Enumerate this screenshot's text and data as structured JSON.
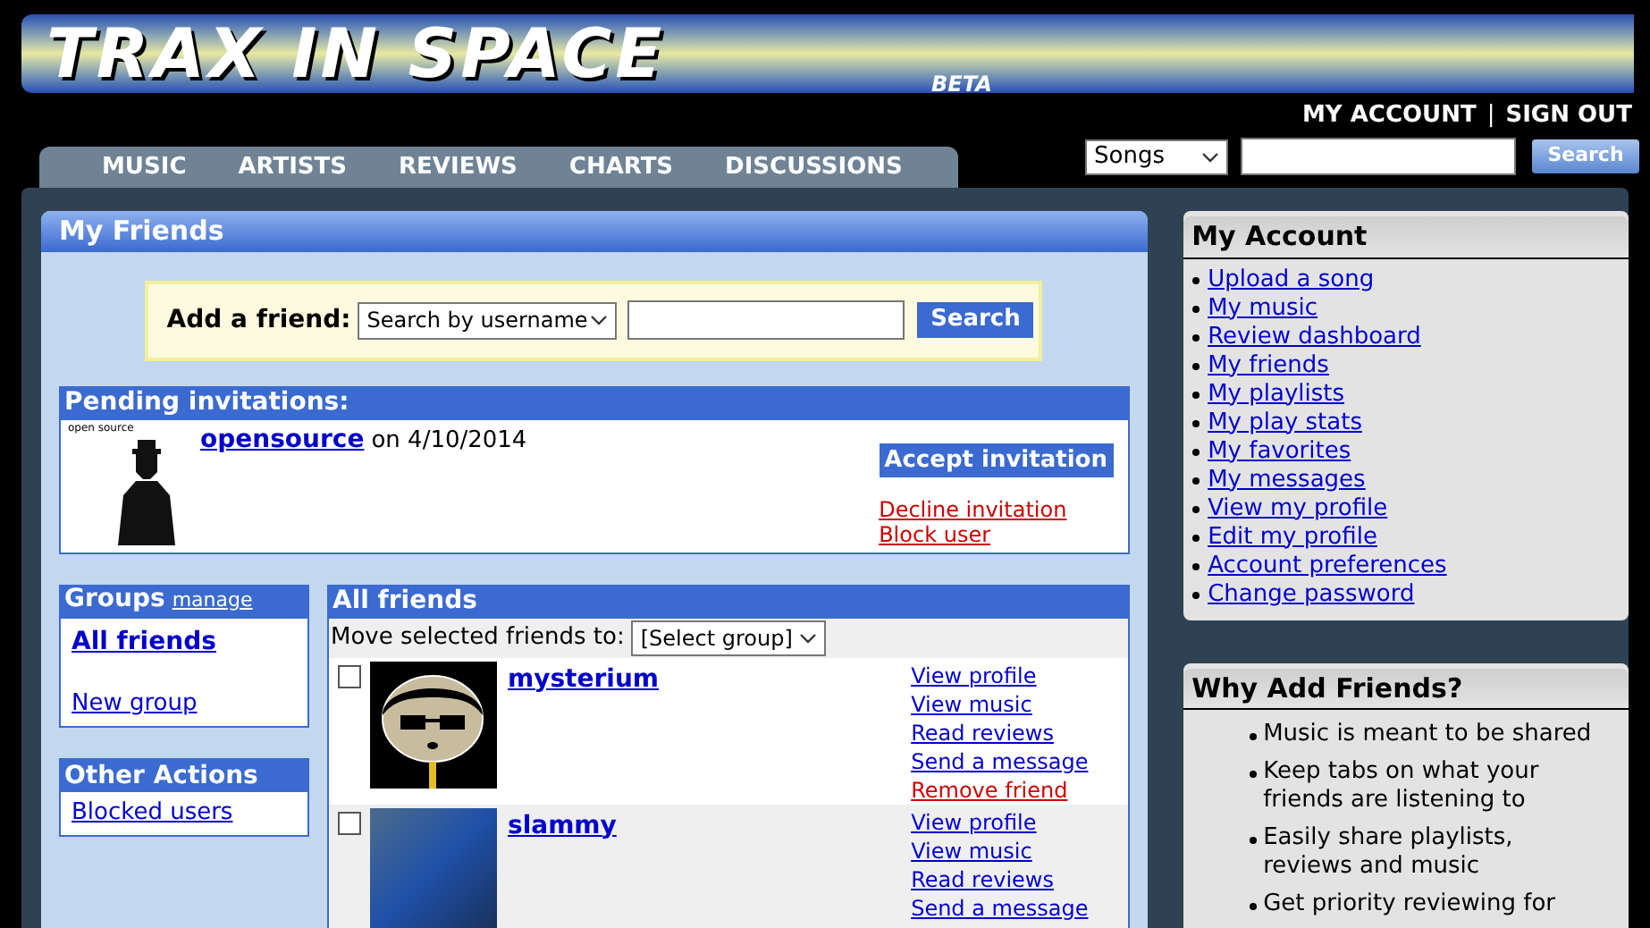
{
  "logo": {
    "title": "TRAX IN SPACE",
    "badge": "BETA"
  },
  "account_links": [
    "MY ACCOUNT",
    "SIGN OUT"
  ],
  "separator": "|",
  "nav_tabs": [
    "MUSIC",
    "ARTISTS",
    "REVIEWS",
    "CHARTS",
    "DISCUSSIONS"
  ],
  "site_search": {
    "category": "Songs",
    "button": "Search"
  },
  "main": {
    "title": "My Friends",
    "add_friend": {
      "label": "Add a friend:",
      "mode": "Search by username",
      "button": "Search"
    },
    "pending": {
      "title": "Pending invitations:",
      "items": [
        {
          "user": "opensource",
          "date_text": "on 4/10/2014",
          "avatar_caption": "open source",
          "accept": "Accept invitation",
          "decline": "Decline invitation",
          "block": "Block user"
        }
      ]
    },
    "groups": {
      "title": "Groups",
      "manage": "manage",
      "items": [
        {
          "label": "All friends",
          "selected": true
        },
        {
          "label": "New group",
          "selected": false
        }
      ]
    },
    "other_actions": {
      "title": "Other Actions",
      "items": [
        "Blocked users"
      ]
    },
    "all_friends": {
      "title": "All friends",
      "move_label": "Move selected friends to:",
      "move_select": "[Select group]",
      "rows": [
        {
          "name": "mysterium",
          "checked": false,
          "kind": "cartoon",
          "links": [
            {
              "label": "View profile",
              "kind": "normal"
            },
            {
              "label": "View music",
              "kind": "normal"
            },
            {
              "label": "Read reviews",
              "kind": "normal"
            },
            {
              "label": "Send a message",
              "kind": "normal"
            },
            {
              "label": "Remove friend",
              "kind": "danger"
            }
          ]
        },
        {
          "name": "slammy",
          "checked": false,
          "kind": "photo",
          "links": [
            {
              "label": "View profile",
              "kind": "normal"
            },
            {
              "label": "View music",
              "kind": "normal"
            },
            {
              "label": "Read reviews",
              "kind": "normal"
            },
            {
              "label": "Send a message",
              "kind": "normal"
            }
          ]
        }
      ]
    }
  },
  "sidebar": {
    "account": {
      "title": "My Account",
      "links": [
        "Upload a song",
        "My music",
        "Review dashboard",
        "My friends",
        "My playlists",
        "My play stats",
        "My favorites",
        "My messages",
        "View my profile",
        "Edit my profile",
        "Account preferences",
        "Change password"
      ]
    },
    "why": {
      "title": "Why Add Friends?",
      "points": [
        "Music is meant to be shared",
        "Keep tabs on what your friends are listening to",
        "Easily share playlists, reviews and music",
        "Get priority reviewing for"
      ]
    }
  }
}
